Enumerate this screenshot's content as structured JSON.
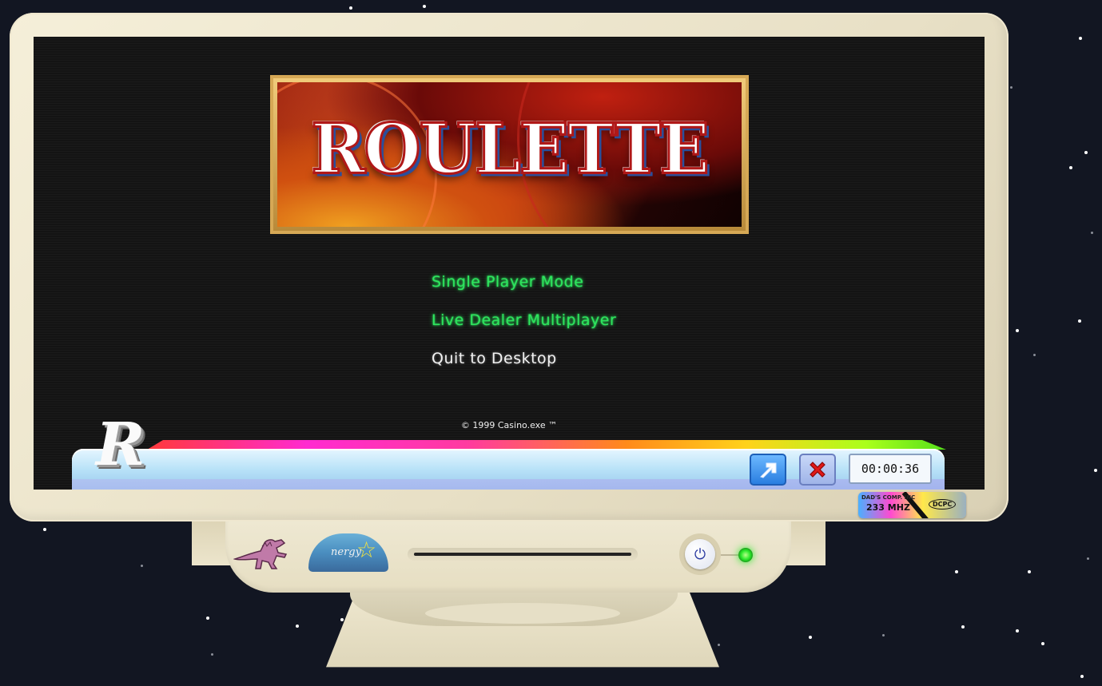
{
  "banner": {
    "title": "ROULETTE"
  },
  "menu": {
    "items": [
      {
        "label": "Single Player Mode",
        "style": "highlight"
      },
      {
        "label": "Live Dealer Multiplayer",
        "style": "highlight"
      },
      {
        "label": "Quit to Desktop",
        "style": "normal"
      }
    ]
  },
  "footer": {
    "copyright": "© 1999 Casino.exe ™"
  },
  "taskbar": {
    "logo": "R",
    "open_button_icon": "arrow-up-right-icon",
    "close_button_icon": "close-x-icon",
    "clock": "00:00:36"
  },
  "badge": {
    "brand": "DAD'S COMP. INC",
    "speed": "233 MHZ",
    "model": "DCPC"
  },
  "stickers": {
    "dino": "dinosaur-sticker",
    "energy": "nergy"
  },
  "colors": {
    "menu_highlight": "#2ee55e",
    "menu_normal": "#f2f2f2",
    "power_led": "#2ae82a",
    "taskbar": "#b8e2f8"
  }
}
